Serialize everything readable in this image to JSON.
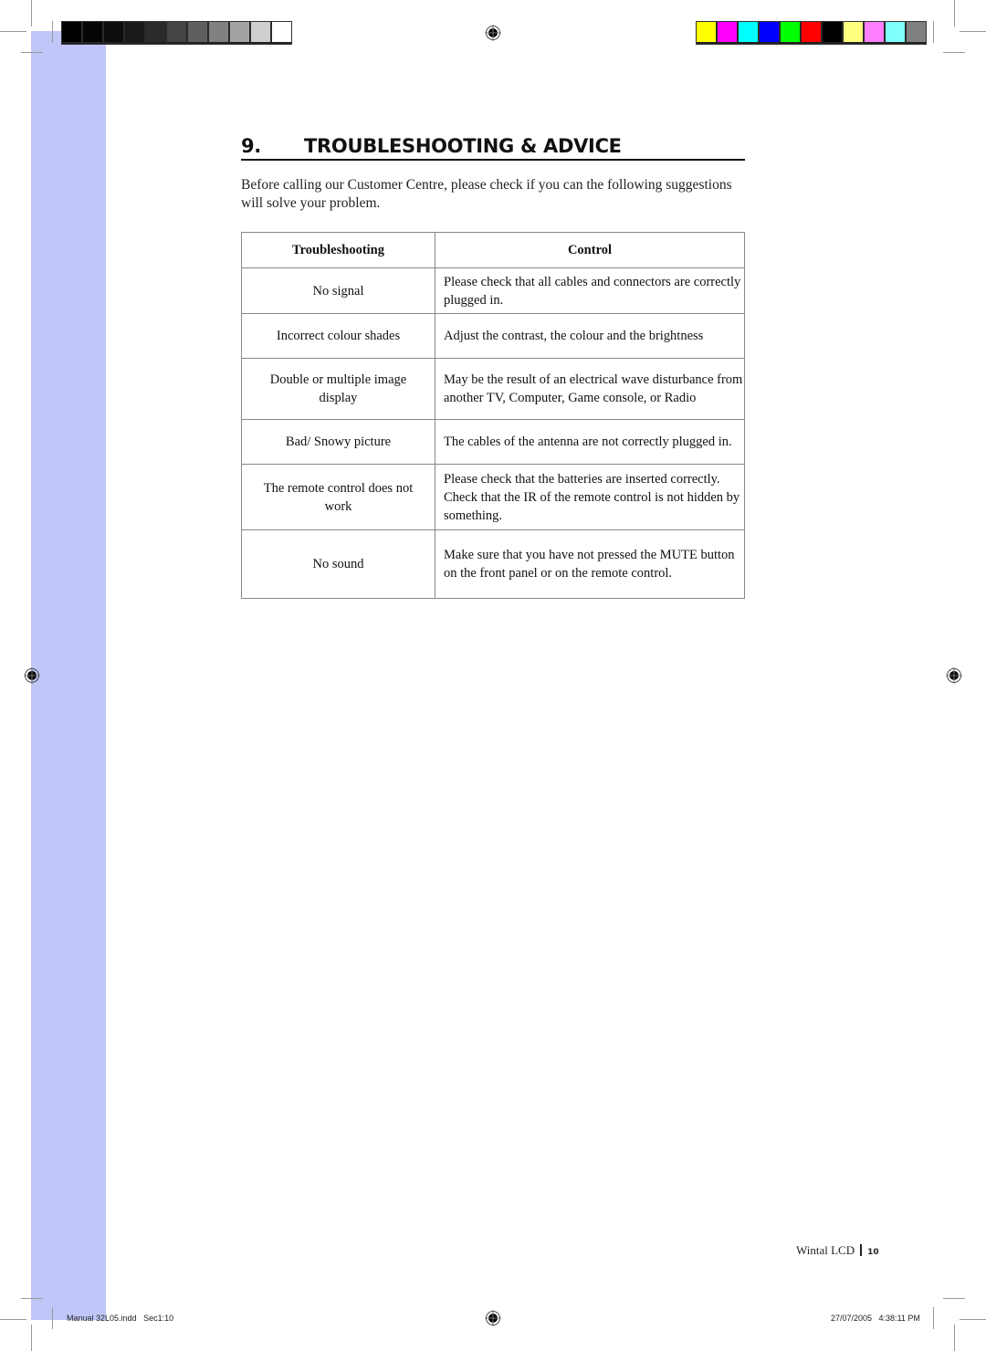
{
  "print_marks": {
    "grayscale_bar": [
      "#000000",
      "#050505",
      "#0d0d0d",
      "#1a1a1a",
      "#2b2b2b",
      "#444444",
      "#5f5f5f",
      "#808080",
      "#a3a3a3",
      "#cfcfcf",
      "#ffffff"
    ],
    "color_bar": [
      "#ffff00",
      "#ff00ff",
      "#00ffff",
      "#0000ff",
      "#00ff00",
      "#ff0000",
      "#000000",
      "#ffff80",
      "#ff80ff",
      "#80ffff",
      "#808080"
    ],
    "bleed_color": "#c0c6f8",
    "registration_icon": "registration-target-icon"
  },
  "section": {
    "number": "9.",
    "title": "TROUBLESHOOTING & ADVICE",
    "intro": "Before calling our Customer Centre, please check if you can the following suggestions will solve your problem."
  },
  "table": {
    "headers": [
      "Troubleshooting",
      "Control"
    ],
    "rows": [
      {
        "problem": "No signal",
        "control": "Please check that all cables and connectors are correctly plugged in."
      },
      {
        "problem": "Incorrect colour shades",
        "control": "Adjust the contrast, the colour and the brightness"
      },
      {
        "problem": "Double or multiple image display",
        "control": "May be the result of an electrical wave disturbance from another TV, Computer, Game console, or Radio"
      },
      {
        "problem": "Bad/ Snowy picture",
        "control": "The cables of the antenna are not correctly plugged in."
      },
      {
        "problem": "The remote control does not work",
        "control": "Please check that the batteries are inserted correctly. Check that the IR of the remote control is not hidden by something."
      },
      {
        "problem": "No sound",
        "control": "Make sure that you have not pressed the MUTE button on the front panel or on the remote control."
      }
    ]
  },
  "footer": {
    "product": "Wintal LCD",
    "page_number": "10",
    "slug_file": "Manual 32L05.indd   Sec1:10",
    "slug_datetime": "27/07/2005   4:38:11 PM"
  }
}
